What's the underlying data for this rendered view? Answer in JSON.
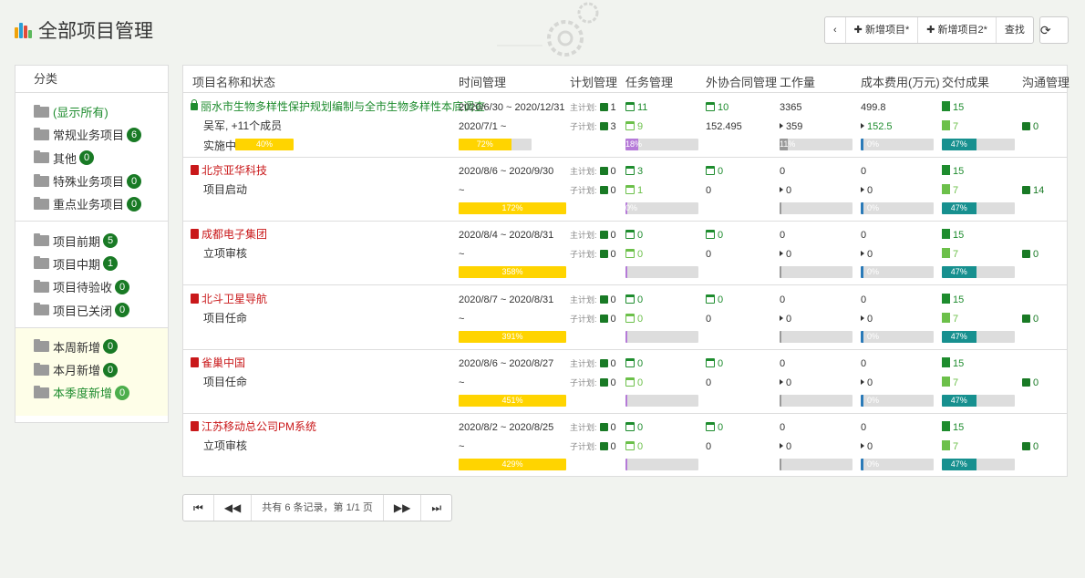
{
  "page": {
    "title": "全部项目管理"
  },
  "toolbar": {
    "prev": "‹",
    "add1": "✚ 新增项目*",
    "add2": "✚ 新增项目2*",
    "search": "查找",
    "refresh": "⟳"
  },
  "sidebar": {
    "header": "分类",
    "group1": [
      {
        "label": "(显示所有)",
        "badge": null
      },
      {
        "label": "常规业务项目",
        "badge": "6"
      },
      {
        "label": "其他",
        "badge": "0"
      },
      {
        "label": "特殊业务项目",
        "badge": "0"
      },
      {
        "label": "重点业务项目",
        "badge": "0"
      }
    ],
    "group2": [
      {
        "label": "项目前期",
        "badge": "5"
      },
      {
        "label": "项目中期",
        "badge": "1"
      },
      {
        "label": "项目待验收",
        "badge": "0"
      },
      {
        "label": "项目已关闭",
        "badge": "0"
      }
    ],
    "group3": [
      {
        "label": "本周新增",
        "badge": "0"
      },
      {
        "label": "本月新增",
        "badge": "0"
      },
      {
        "label": "本季度新增",
        "badge": "0"
      }
    ]
  },
  "table": {
    "headers": [
      "项目名称和状态",
      "时间管理",
      "计划管理",
      "任务管理",
      "外协合同管理",
      "工作量",
      "成本费用(万元)",
      "交付成果",
      "沟通管理"
    ],
    "plan_main_label": "主计划:",
    "plan_sub_label": "子计划:",
    "rows": [
      {
        "name": "丽水市生物多样性保护规划编制与全市生物多样性本底调查",
        "locked": true,
        "sub": "吴军, +11个成员",
        "status": "实施中",
        "status_pct": "40%",
        "status_frac": 0.4,
        "date1": "2020/6/30 ~ 2020/12/31",
        "date2": "2020/7/1 ~",
        "time_pct": "72%",
        "time_frac": 0.72,
        "plan_main": "1",
        "plan_sub": "3",
        "task1": "11",
        "task2": "9",
        "task_pct": "18%",
        "task_frac": 0.18,
        "contract1": "10",
        "contract2": "152.495",
        "work1": "3365",
        "work2": "359",
        "work_pct": "11%",
        "work_frac": 0.11,
        "cost1": "499.8",
        "cost2": "152.5",
        "cost_pct": "0%",
        "deliv1": "15",
        "deliv2": "7",
        "deliv_pct": "47%",
        "deliv_frac": 0.47,
        "comm": "0"
      },
      {
        "name": "北京亚华科技",
        "locked": false,
        "sub": "项目启动",
        "status": "",
        "status_pct": "",
        "status_frac": 0,
        "date1": "2020/8/6 ~ 2020/9/30",
        "date2": "~",
        "time_pct": "172%",
        "time_frac": 1,
        "plan_main": "0",
        "plan_sub": "0",
        "task1": "3",
        "task2": "1",
        "task_pct": "0%",
        "task_frac": 0,
        "contract1": "0",
        "contract2": "0",
        "work1": "0",
        "work2": "0",
        "work_pct": "",
        "work_frac": 0,
        "cost1": "0",
        "cost2": "0",
        "cost_pct": "0%",
        "deliv1": "15",
        "deliv2": "7",
        "deliv_pct": "47%",
        "deliv_frac": 0.47,
        "comm": "14"
      },
      {
        "name": "成都电子集团",
        "locked": false,
        "sub": "立项审核",
        "status": "",
        "status_pct": "",
        "status_frac": 0,
        "date1": "2020/8/4 ~ 2020/8/31",
        "date2": "~",
        "time_pct": "358%",
        "time_frac": 1,
        "plan_main": "0",
        "plan_sub": "0",
        "task1": "0",
        "task2": "0",
        "task_pct": "",
        "task_frac": 0,
        "contract1": "0",
        "contract2": "0",
        "work1": "0",
        "work2": "0",
        "work_pct": "",
        "work_frac": 0,
        "cost1": "0",
        "cost2": "0",
        "cost_pct": "0%",
        "deliv1": "15",
        "deliv2": "7",
        "deliv_pct": "47%",
        "deliv_frac": 0.47,
        "comm": "0"
      },
      {
        "name": "北斗卫星导航",
        "locked": false,
        "sub": "项目任命",
        "status": "",
        "status_pct": "",
        "status_frac": 0,
        "date1": "2020/8/7 ~ 2020/8/31",
        "date2": "~",
        "time_pct": "391%",
        "time_frac": 1,
        "plan_main": "0",
        "plan_sub": "0",
        "task1": "0",
        "task2": "0",
        "task_pct": "",
        "task_frac": 0,
        "contract1": "0",
        "contract2": "0",
        "work1": "0",
        "work2": "0",
        "work_pct": "",
        "work_frac": 0,
        "cost1": "0",
        "cost2": "0",
        "cost_pct": "0%",
        "deliv1": "15",
        "deliv2": "7",
        "deliv_pct": "47%",
        "deliv_frac": 0.47,
        "comm": "0"
      },
      {
        "name": "雀巢中国",
        "locked": false,
        "sub": "项目任命",
        "status": "",
        "status_pct": "",
        "status_frac": 0,
        "date1": "2020/8/6 ~ 2020/8/27",
        "date2": "~",
        "time_pct": "451%",
        "time_frac": 1,
        "plan_main": "0",
        "plan_sub": "0",
        "task1": "0",
        "task2": "0",
        "task_pct": "",
        "task_frac": 0,
        "contract1": "0",
        "contract2": "0",
        "work1": "0",
        "work2": "0",
        "work_pct": "",
        "work_frac": 0,
        "cost1": "0",
        "cost2": "0",
        "cost_pct": "0%",
        "deliv1": "15",
        "deliv2": "7",
        "deliv_pct": "47%",
        "deliv_frac": 0.47,
        "comm": "0"
      },
      {
        "name": "江苏移动总公司PM系统",
        "locked": false,
        "sub": "立项审核",
        "status": "",
        "status_pct": "",
        "status_frac": 0,
        "date1": "2020/8/2 ~ 2020/8/25",
        "date2": "~",
        "time_pct": "429%",
        "time_frac": 1,
        "plan_main": "0",
        "plan_sub": "0",
        "task1": "0",
        "task2": "0",
        "task_pct": "",
        "task_frac": 0,
        "contract1": "0",
        "contract2": "0",
        "work1": "0",
        "work2": "0",
        "work_pct": "",
        "work_frac": 0,
        "cost1": "0",
        "cost2": "0",
        "cost_pct": "0%",
        "deliv1": "15",
        "deliv2": "7",
        "deliv_pct": "47%",
        "deliv_frac": 0.47,
        "comm": "0"
      }
    ]
  },
  "pager": {
    "first": "⏮",
    "prev": "◀◀",
    "info": "共有 6 条记录，第 1/1 页",
    "next": "▶▶",
    "last": "⏭"
  },
  "colors": {
    "accent_green": "#197a25",
    "red": "#c9181a",
    "yellow": "#ffd400",
    "purple": "#b57ad8",
    "teal": "#17908f",
    "gray_bar": "#999999"
  }
}
